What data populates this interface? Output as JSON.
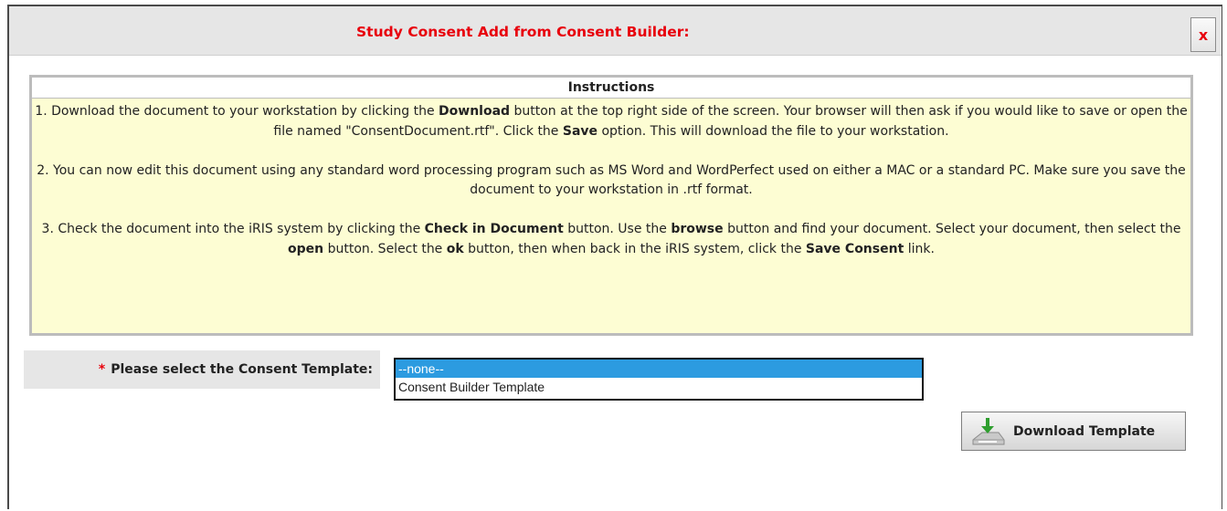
{
  "dialog": {
    "title": "Study Consent Add from Consent Builder:",
    "close_label": "x"
  },
  "instructions": {
    "heading": "Instructions",
    "steps": [
      [
        {
          "t": "1. Download the document to your workstation by clicking the "
        },
        {
          "t": "Download",
          "b": true
        },
        {
          "t": " button at the top right side of the screen. Your browser will then ask if you would like to save or open the file named \"ConsentDocument.rtf\". Click the "
        },
        {
          "t": "Save",
          "b": true
        },
        {
          "t": " option. This will download the file to your workstation."
        }
      ],
      [
        {
          "t": "2. You can now edit this document using any standard word processing program such as MS Word and WordPerfect used on either a MAC or a standard PC. Make sure you save the document to your workstation in .rtf format."
        }
      ],
      [
        {
          "t": "3. Check the document into the iRIS system by clicking the "
        },
        {
          "t": "Check in Document",
          "b": true
        },
        {
          "t": " button. Use the "
        },
        {
          "t": "browse",
          "b": true
        },
        {
          "t": " button and find your document. Select your document, then select the "
        },
        {
          "t": "open",
          "b": true
        },
        {
          "t": " button. Select the "
        },
        {
          "t": "ok",
          "b": true
        },
        {
          "t": " button, then when back in the iRIS system, click the "
        },
        {
          "t": "Save Consent",
          "b": true
        },
        {
          "t": " link."
        }
      ]
    ]
  },
  "form": {
    "required_marker": "*",
    "template_label": "Please select the Consent Template:",
    "template_options": [
      "--none--",
      "Consent Builder Template"
    ],
    "selected_index": 0
  },
  "download_button": {
    "label": "Download Template",
    "icon": "download-icon"
  },
  "colors": {
    "title_red": "#e8000c",
    "instructions_bg": "#fdfdd3",
    "selected_option_bg": "#2c9be0"
  }
}
